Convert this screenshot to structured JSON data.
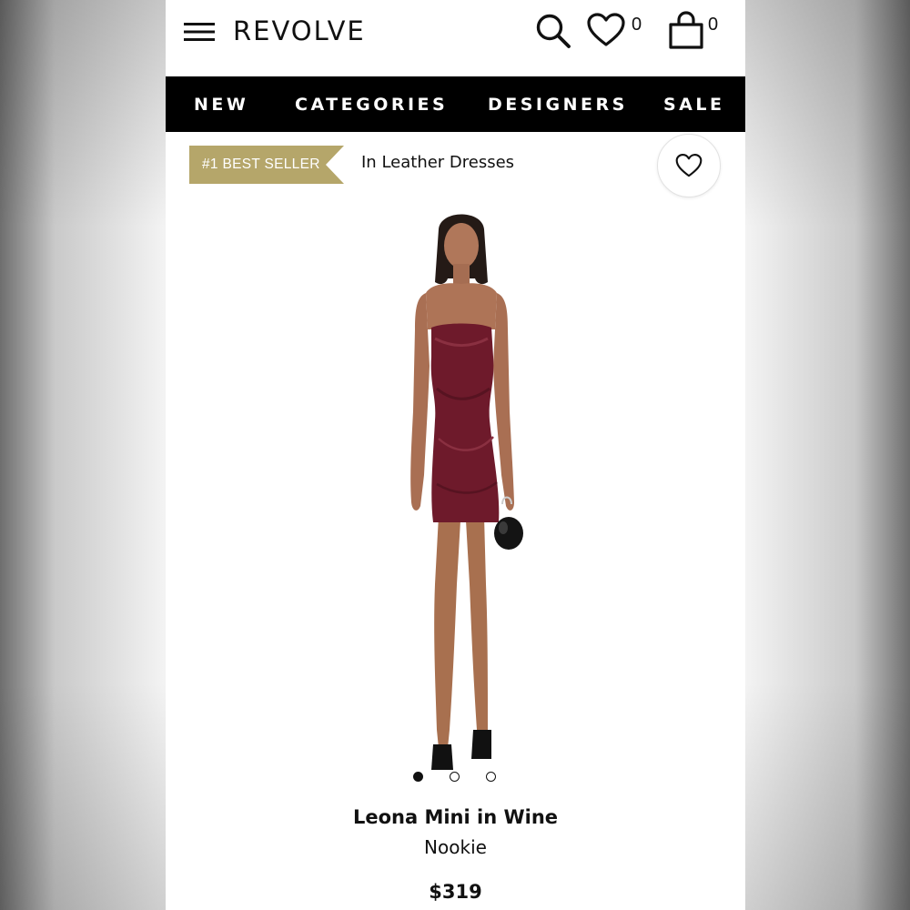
{
  "header": {
    "logo": "REVOLVE",
    "wishlist_count": "0",
    "bag_count": "0",
    "icons": [
      "menu-icon",
      "search-icon",
      "heart-icon",
      "shopping-bag-icon"
    ]
  },
  "nav": {
    "items": [
      {
        "label": "NEW"
      },
      {
        "label": "CATEGORIES"
      },
      {
        "label": "DESIGNERS"
      },
      {
        "label": "SALE"
      }
    ]
  },
  "badge": {
    "label": "#1 BEST SELLER",
    "context": "In Leather Dresses",
    "color": "#b5a66a"
  },
  "product": {
    "name": "Leona Mini in Wine",
    "brand": "Nookie",
    "price": "$319",
    "dress_color": "#6e1a2b",
    "image_count": 3,
    "active_image": 1
  }
}
